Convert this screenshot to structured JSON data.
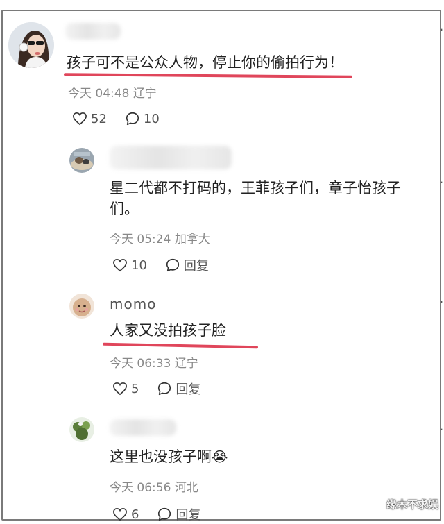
{
  "comments": [
    {
      "username": "",
      "text": "孩子可不是公众人物，停止你的偷拍行为！",
      "time": "今天 04:48",
      "location": "辽宁",
      "likes": "52",
      "replies": "10"
    },
    {
      "username": "",
      "text_line1": "星二代都不打码的，王菲孩子们，章子怡孩子",
      "text_line2": "们。",
      "time": "今天 05:24",
      "location": "加拿大",
      "likes": "10",
      "reply_label": "回复"
    },
    {
      "username": "momo",
      "text": "人家又没拍孩子脸",
      "time": "今天 06:33",
      "location": "辽宁",
      "likes": "5",
      "reply_label": "回复"
    },
    {
      "username": "",
      "text": "这里也没孩子啊",
      "emoji": "😭",
      "time": "今天 06:56",
      "location": "河北",
      "likes": "6",
      "reply_label": "回复"
    }
  ],
  "watermark": "缘木不求娱",
  "colors": {
    "underline": "#e0465b",
    "meta": "#888888"
  }
}
